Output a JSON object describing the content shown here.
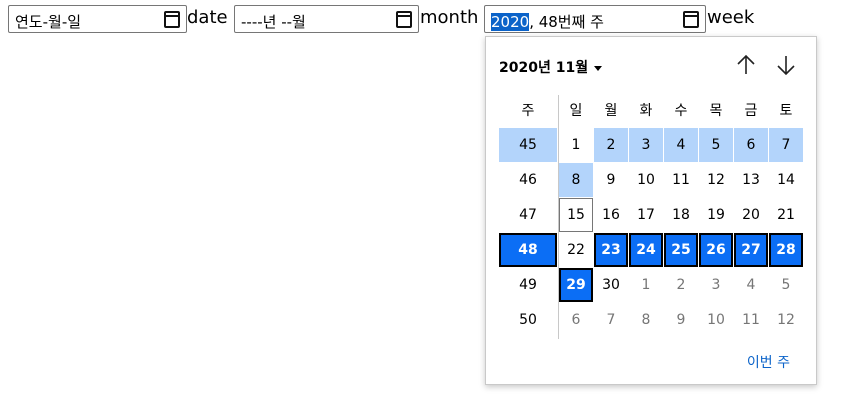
{
  "inputs": {
    "date": {
      "value": "연도-월-일",
      "label": "date"
    },
    "month": {
      "value": "----년 --월",
      "label": "month"
    },
    "week": {
      "year_part": "2020",
      "rest_part": ", 48번째 주",
      "label": "week"
    }
  },
  "picker": {
    "month_label": "2020년 11월",
    "headers": [
      "주",
      "일",
      "월",
      "화",
      "수",
      "목",
      "금",
      "토"
    ],
    "weeks": [
      {
        "num": "45",
        "days": [
          "1",
          "2",
          "3",
          "4",
          "5",
          "6",
          "7"
        ]
      },
      {
        "num": "46",
        "days": [
          "8",
          "9",
          "10",
          "11",
          "12",
          "13",
          "14"
        ]
      },
      {
        "num": "47",
        "days": [
          "15",
          "16",
          "17",
          "18",
          "19",
          "20",
          "21"
        ]
      },
      {
        "num": "48",
        "days": [
          "22",
          "23",
          "24",
          "25",
          "26",
          "27",
          "28"
        ]
      },
      {
        "num": "49",
        "days": [
          "29",
          "30",
          "1",
          "2",
          "3",
          "4",
          "5"
        ]
      },
      {
        "num": "50",
        "days": [
          "6",
          "7",
          "8",
          "9",
          "10",
          "11",
          "12"
        ]
      }
    ],
    "selected_week": "48",
    "hover_week": "45",
    "today": "15",
    "this_week_label": "이번 주"
  },
  "colors": {
    "selected": "#0b6ef5",
    "hover": "#b3d4fb",
    "link": "#0b63c9"
  },
  "icons": [
    "calendar-icon",
    "caret-down-icon",
    "arrow-up-icon",
    "arrow-down-icon"
  ]
}
